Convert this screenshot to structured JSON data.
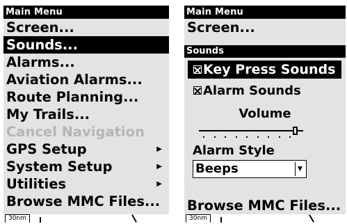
{
  "left_screen": {
    "menu_title": "Main Menu",
    "items": [
      {
        "label": "Screen...",
        "selected": false,
        "disabled": false,
        "submenu": false
      },
      {
        "label": "Sounds...",
        "selected": true,
        "disabled": false,
        "submenu": false
      },
      {
        "label": "Alarms...",
        "selected": false,
        "disabled": false,
        "submenu": false
      },
      {
        "label": "Aviation Alarms...",
        "selected": false,
        "disabled": false,
        "submenu": false
      },
      {
        "label": "Route Planning...",
        "selected": false,
        "disabled": false,
        "submenu": false
      },
      {
        "label": "My Trails...",
        "selected": false,
        "disabled": false,
        "submenu": false
      },
      {
        "label": "Cancel Navigation",
        "selected": false,
        "disabled": true,
        "submenu": false
      },
      {
        "label": "GPS Setup",
        "selected": false,
        "disabled": false,
        "submenu": true
      },
      {
        "label": "System Setup",
        "selected": false,
        "disabled": false,
        "submenu": true
      },
      {
        "label": "Utilities",
        "selected": false,
        "disabled": false,
        "submenu": true
      },
      {
        "label": "Browse MMC Files...",
        "selected": false,
        "disabled": false,
        "submenu": false
      }
    ],
    "submenu_arrow_glyph": "▶",
    "map_scale": "30nm"
  },
  "right_screen": {
    "menu_title": "Main Menu",
    "visible_items": [
      "Screen...",
      "Browse MMC Files..."
    ],
    "map_scale": "30nm",
    "dialog": {
      "title": "Sounds",
      "key_press_sounds": {
        "label": "Key Press Sounds",
        "checked": true,
        "focused": true
      },
      "alarm_sounds": {
        "label": "Alarm Sounds",
        "checked": true,
        "focused": false
      },
      "volume_label": "Volume",
      "volume_level": 0.9,
      "alarm_style_label": "Alarm Style",
      "alarm_style_value": "Beeps",
      "dropdown_arrow_glyph": "▼"
    }
  }
}
